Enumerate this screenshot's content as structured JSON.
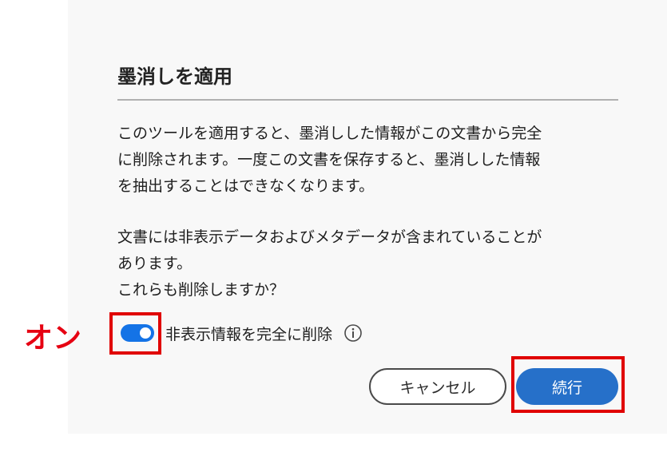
{
  "dialog": {
    "title": "墨消しを適用",
    "paragraph1": [
      "このツールを適用すると、墨消しした情報がこの文書から完全",
      "に削除されます。一度この文書を保存すると、墨消しした情報",
      "を抽出することはできなくなります。"
    ],
    "paragraph2": [
      "文書には非表示データおよびメタデータが含まれていることが",
      "あります。",
      "これらも削除しますか？"
    ],
    "toggle": {
      "label": "非表示情報を完全に削除",
      "state": "on",
      "icon": "info-icon"
    },
    "buttons": {
      "cancel": "キャンセル",
      "continue": "続行"
    }
  },
  "annotation": {
    "toggle_callout": "オン",
    "highlight_color": "#e00000"
  },
  "colors": {
    "accent": "#1473e6",
    "primary_button": "#2670c9"
  }
}
